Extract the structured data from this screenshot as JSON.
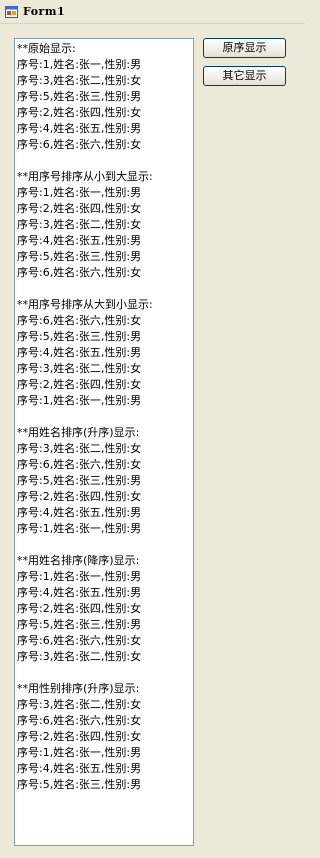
{
  "window": {
    "title": "Form1"
  },
  "buttons": {
    "original_order": "原序显示",
    "other_display": "其它显示"
  },
  "output_lines": [
    "**原始显示:",
    "序号:1,姓名:张一,性别:男",
    "序号:3,姓名:张二,性别:女",
    "序号:5,姓名:张三,性别:男",
    "序号:2,姓名:张四,性别:女",
    "序号:4,姓名:张五,性别:男",
    "序号:6,姓名:张六,性别:女",
    "",
    "**用序号排序从小到大显示:",
    "序号:1,姓名:张一,性别:男",
    "序号:2,姓名:张四,性别:女",
    "序号:3,姓名:张二,性别:女",
    "序号:4,姓名:张五,性别:男",
    "序号:5,姓名:张三,性别:男",
    "序号:6,姓名:张六,性别:女",
    "",
    "**用序号排序从大到小显示:",
    "序号:6,姓名:张六,性别:女",
    "序号:5,姓名:张三,性别:男",
    "序号:4,姓名:张五,性别:男",
    "序号:3,姓名:张二,性别:女",
    "序号:2,姓名:张四,性别:女",
    "序号:1,姓名:张一,性别:男",
    "",
    "**用姓名排序(升序)显示:",
    "序号:3,姓名:张二,性别:女",
    "序号:6,姓名:张六,性别:女",
    "序号:5,姓名:张三,性别:男",
    "序号:2,姓名:张四,性别:女",
    "序号:4,姓名:张五,性别:男",
    "序号:1,姓名:张一,性别:男",
    "",
    "**用姓名排序(降序)显示:",
    "序号:1,姓名:张一,性别:男",
    "序号:4,姓名:张五,性别:男",
    "序号:2,姓名:张四,性别:女",
    "序号:5,姓名:张三,性别:男",
    "序号:6,姓名:张六,性别:女",
    "序号:3,姓名:张二,性别:女",
    "",
    "**用性别排序(升序)显示:",
    "序号:3,姓名:张二,性别:女",
    "序号:6,姓名:张六,性别:女",
    "序号:2,姓名:张四,性别:女",
    "序号:1,姓名:张一,性别:男",
    "序号:4,姓名:张五,性别:男",
    "序号:5,姓名:张三,性别:男"
  ]
}
